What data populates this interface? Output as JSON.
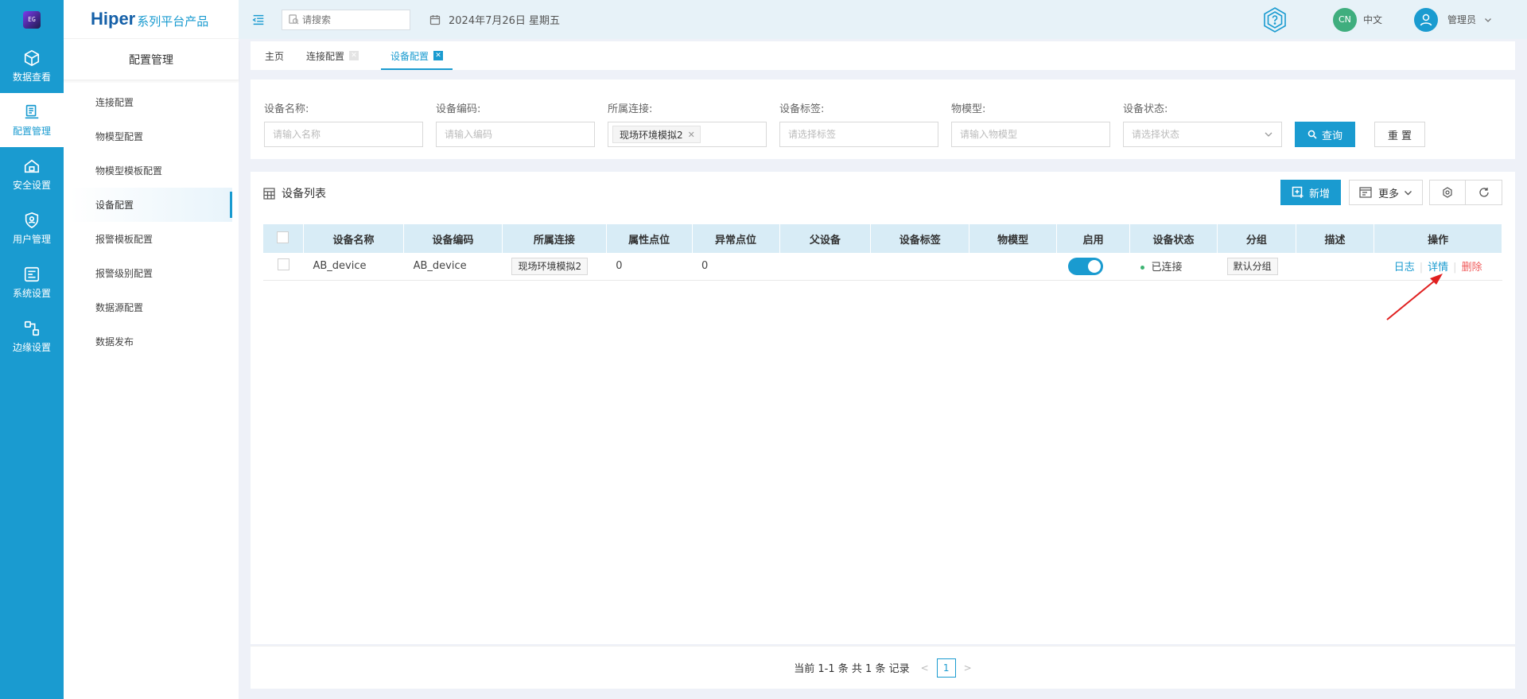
{
  "rail": {
    "items": [
      {
        "label": "数据查看",
        "icon": "cube-icon"
      },
      {
        "label": "配置管理",
        "icon": "config-doc-icon",
        "active": true
      },
      {
        "label": "安全设置",
        "icon": "house-lock-icon"
      },
      {
        "label": "用户管理",
        "icon": "user-shield-icon"
      },
      {
        "label": "系统设置",
        "icon": "system-settings-icon"
      },
      {
        "label": "边缘设置",
        "icon": "edge-nodes-icon"
      }
    ]
  },
  "brand": {
    "main": "Hiper",
    "sub": "系列平台产品"
  },
  "sidebar": {
    "title": "配置管理",
    "items": [
      "连接配置",
      "物模型配置",
      "物模型模板配置",
      "设备配置",
      "报警模板配置",
      "报警级别配置",
      "数据源配置",
      "数据发布"
    ],
    "active_index": 3
  },
  "topbar": {
    "search_placeholder": "请搜索",
    "date": "2024年7月26日 星期五",
    "lang_badge": "CN",
    "lang_label": "中文",
    "user_name": "管理员"
  },
  "tabs": [
    {
      "label": "主页",
      "closable": false
    },
    {
      "label": "连接配置",
      "closable": true
    },
    {
      "label": "设备配置",
      "closable": true,
      "active": true
    }
  ],
  "filter": {
    "fields": [
      {
        "label": "设备名称:",
        "placeholder": "请输入名称"
      },
      {
        "label": "设备编码:",
        "placeholder": "请输入编码"
      },
      {
        "label": "所属连接:",
        "tag": "现场环境模拟2"
      },
      {
        "label": "设备标签:",
        "placeholder": "请选择标签"
      },
      {
        "label": "物模型:",
        "placeholder": "请输入物模型"
      },
      {
        "label": "设备状态:",
        "placeholder": "请选择状态"
      }
    ],
    "query_label": "查询",
    "reset_label": "重 置"
  },
  "list": {
    "title": "设备列表",
    "add_label": "新增",
    "more_label": "更多",
    "columns": [
      "设备名称",
      "设备编码",
      "所属连接",
      "属性点位",
      "异常点位",
      "父设备",
      "设备标签",
      "物模型",
      "启用",
      "设备状态",
      "分组",
      "描述",
      "操作"
    ],
    "rows": [
      {
        "name": "AB_device",
        "code": "AB_device",
        "connection": "现场环境模拟2",
        "attr_points": "0",
        "abnormal_points": "0",
        "parent": "",
        "tags": "",
        "model": "",
        "enabled": true,
        "status": "已连接",
        "group": "默认分组",
        "desc": "",
        "ops": [
          "日志",
          "详情",
          "删除"
        ]
      }
    ]
  },
  "pagination": {
    "summary": "当前 1-1 条 共 1 条 记录",
    "current": "1"
  },
  "colors": {
    "primary": "#1a9bd0",
    "danger": "#f05a5a",
    "success": "#3cb371",
    "annotation": "#e02020"
  }
}
